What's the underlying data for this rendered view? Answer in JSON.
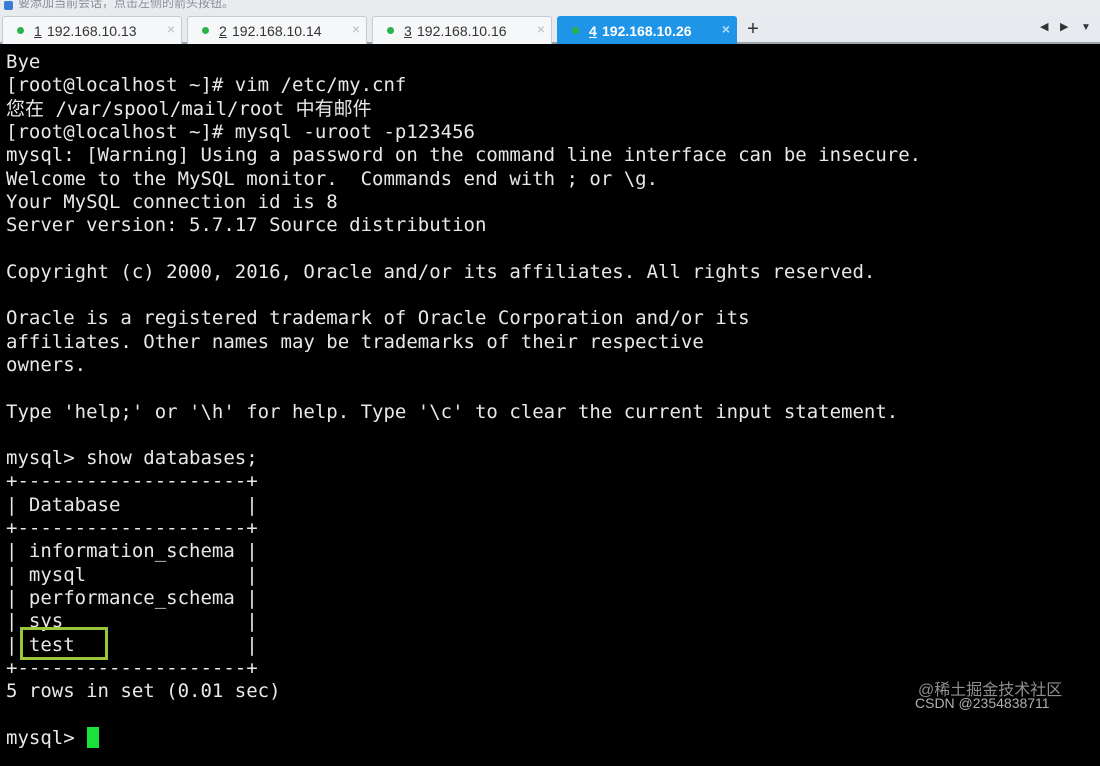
{
  "top_strip": {
    "text": "要添加当前会话，点击左侧的箭头按钮。"
  },
  "tabs": [
    {
      "number": "1",
      "host": "192.168.10.13",
      "active": false
    },
    {
      "number": "2",
      "host": "192.168.10.14",
      "active": false
    },
    {
      "number": "3",
      "host": "192.168.10.16",
      "active": false
    },
    {
      "number": "4",
      "host": "192.168.10.26",
      "active": true
    }
  ],
  "tabbar_controls": {
    "add": "+",
    "left": "◀",
    "right": "▶",
    "menu": "▼",
    "close": "×"
  },
  "terminal": {
    "lines": [
      "Bye",
      "[root@localhost ~]# vim /etc/my.cnf",
      "您在 /var/spool/mail/root 中有邮件",
      "[root@localhost ~]# mysql -uroot -p123456",
      "mysql: [Warning] Using a password on the command line interface can be insecure.",
      "Welcome to the MySQL monitor.  Commands end with ; or \\g.",
      "Your MySQL connection id is 8",
      "Server version: 5.7.17 Source distribution",
      "",
      "Copyright (c) 2000, 2016, Oracle and/or its affiliates. All rights reserved.",
      "",
      "Oracle is a registered trademark of Oracle Corporation and/or its",
      "affiliates. Other names may be trademarks of their respective",
      "owners.",
      "",
      "Type 'help;' or '\\h' for help. Type '\\c' to clear the current input statement.",
      "",
      "mysql> show databases;",
      "+--------------------+",
      "| Database           |",
      "+--------------------+",
      "| information_schema |",
      "| mysql              |",
      "| performance_schema |",
      "| sys                |",
      "| test               |",
      "+--------------------+",
      "5 rows in set (0.01 sec)",
      "",
      "mysql> "
    ],
    "highlighted_row": "test"
  },
  "watermark": {
    "line1": "@稀土掘金技术社区",
    "line2": "CSDN @2354838711"
  },
  "colors": {
    "tab_active": "#1f95e8",
    "cursor": "#19e23a",
    "highlight": "#9bc53d",
    "status_dot": "#2db24a"
  }
}
